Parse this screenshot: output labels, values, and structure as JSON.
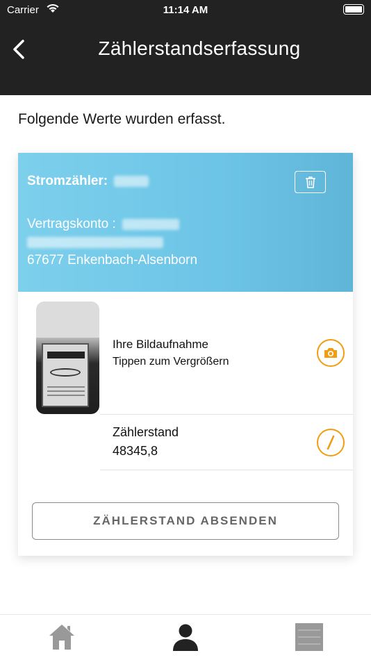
{
  "status_bar": {
    "carrier": "Carrier",
    "time": "11:14 AM",
    "icons": [
      "wifi-icon",
      "battery-icon"
    ]
  },
  "nav": {
    "title": "Zählerstandserfassung",
    "back_icon": "chevron-left-icon"
  },
  "intro_text": "Folgende Werte wurden erfasst.",
  "card": {
    "header_color": "#6cc4e6",
    "meter_label": "Stromzähler:",
    "contract_label": "Vertragskonto :",
    "city": "67677 Enkenbach-Alsenborn",
    "delete_icon": "trash-icon"
  },
  "photo_row": {
    "title": "Ihre Bildaufnahme",
    "subtitle": "Tippen zum Vergrößern",
    "action_icon": "camera-icon"
  },
  "reading_row": {
    "label": "Zählerstand",
    "value": "48345,8",
    "action_icon": "pencil-icon"
  },
  "submit_label": "ZÄHLERSTAND ABSENDEN",
  "accent_color": "#f39c12",
  "tabbar": {
    "tabs": [
      "home-icon",
      "user-icon",
      "menu-icon"
    ]
  }
}
